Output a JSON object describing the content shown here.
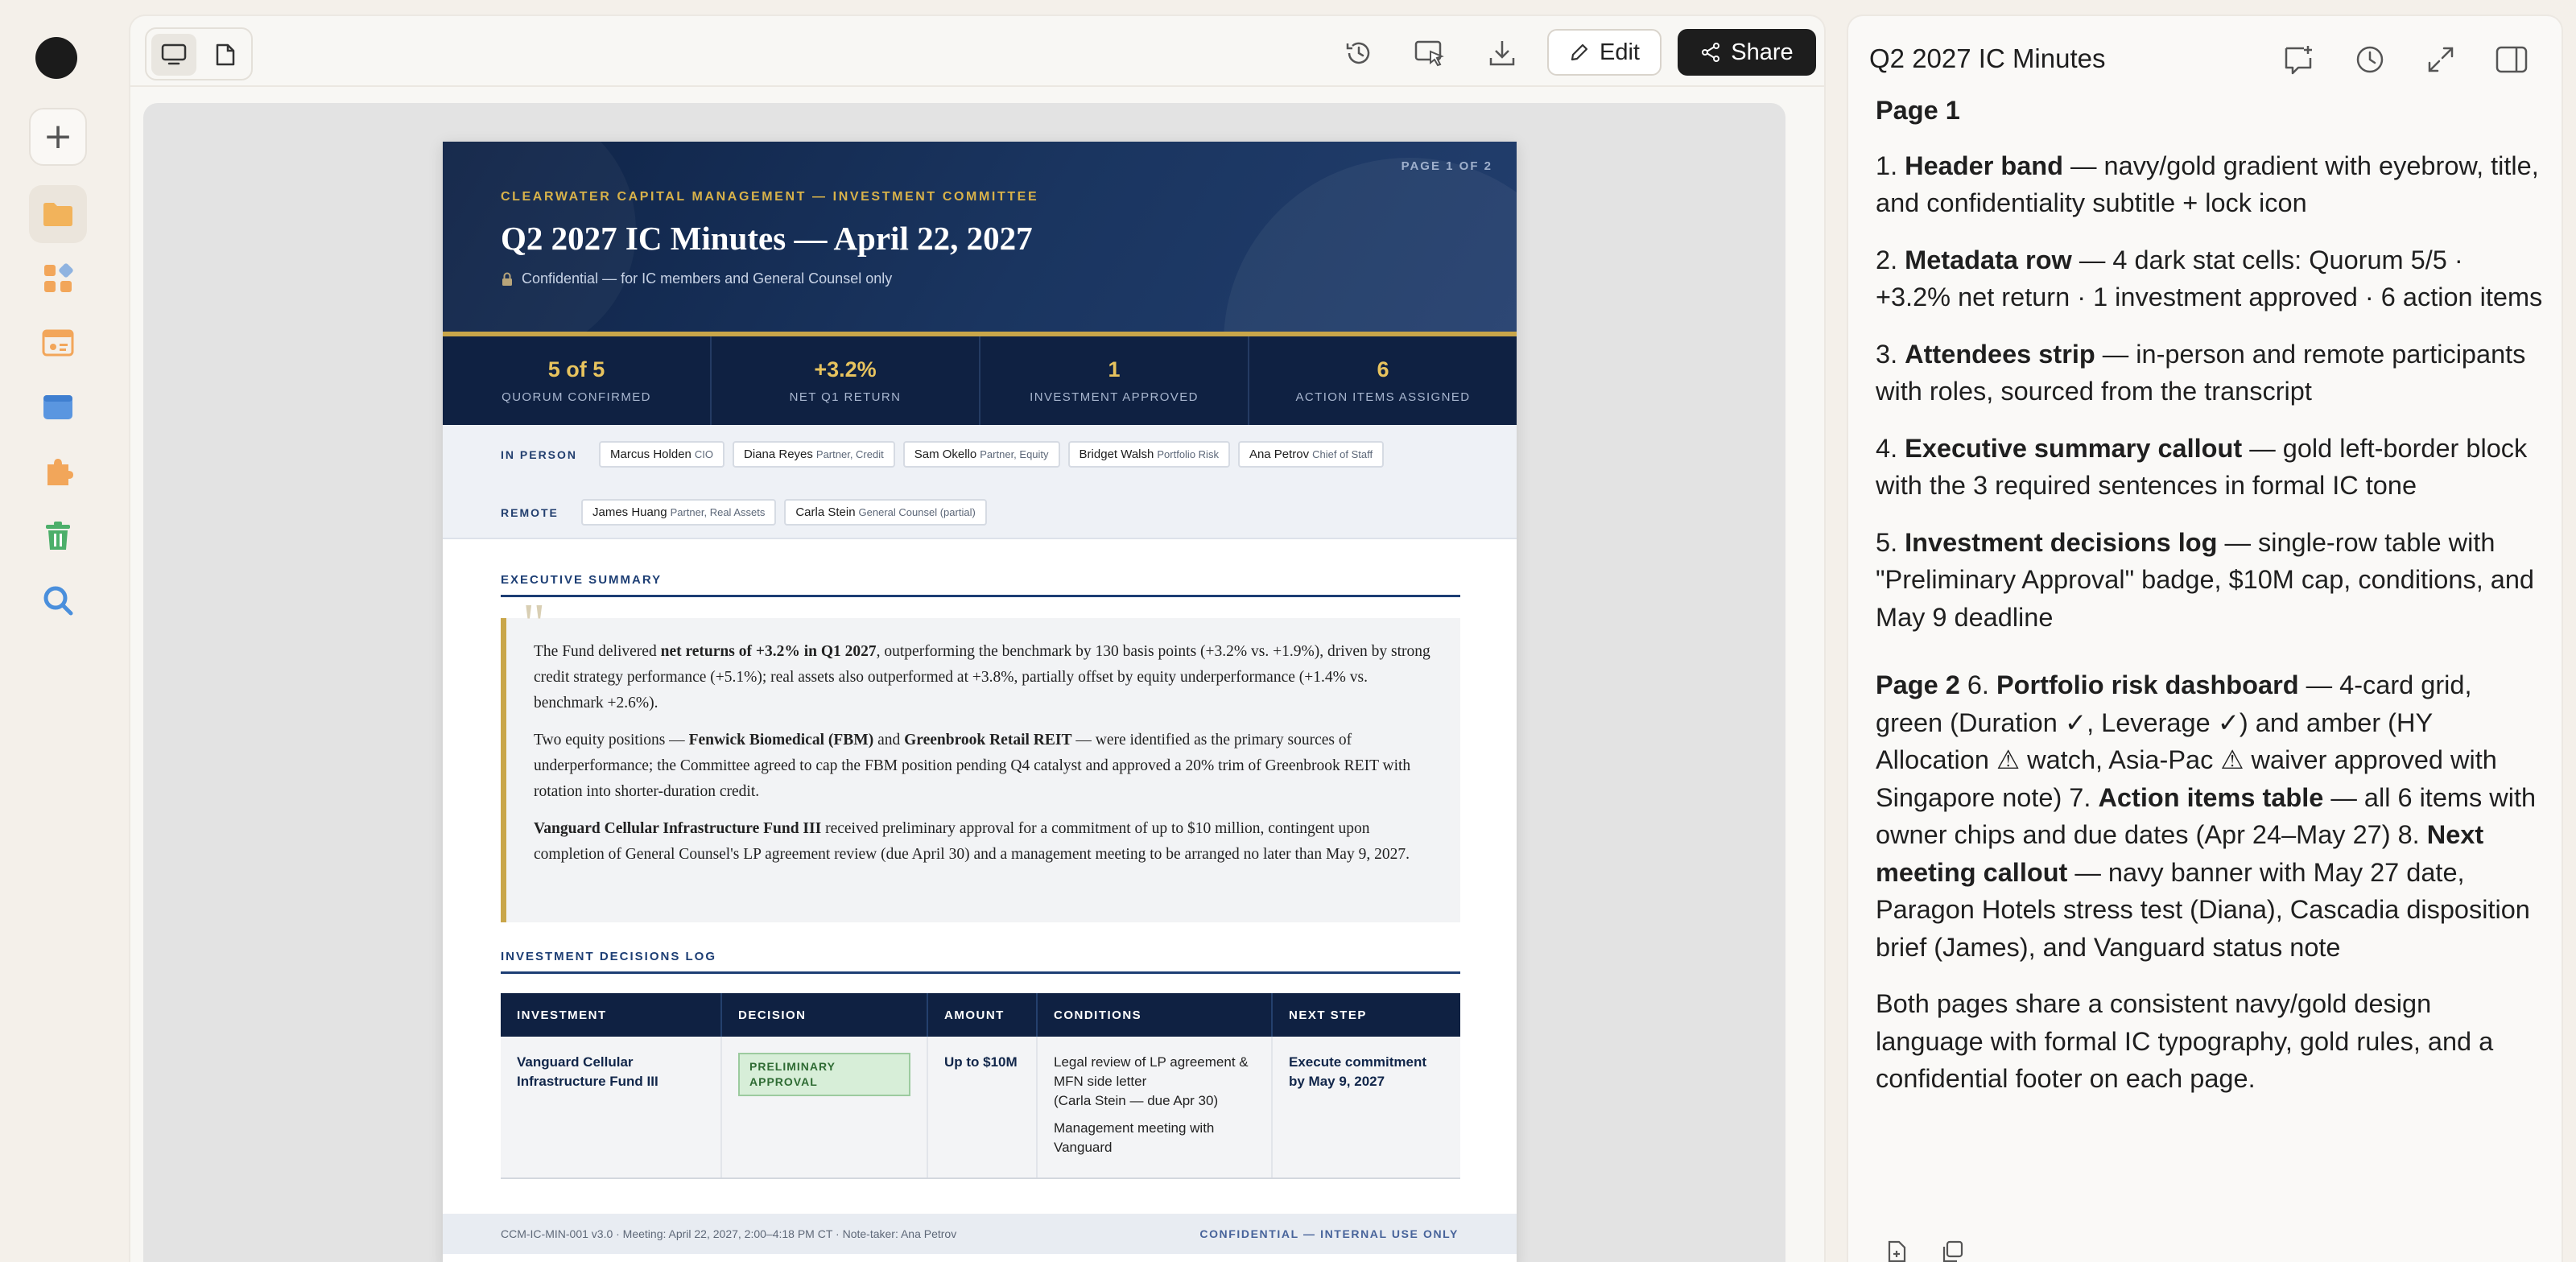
{
  "toolbar": {
    "edit_label": "Edit",
    "share_label": "Share"
  },
  "doc": {
    "page_label": "PAGE 1 OF 2",
    "eyebrow": "CLEARWATER CAPITAL MANAGEMENT — INVESTMENT COMMITTEE",
    "title": "Q2 2027 IC Minutes — April 22, 2027",
    "subtitle": "Confidential — for IC members and General Counsel only",
    "stats": [
      {
        "value": "5 of 5",
        "label": "QUORUM CONFIRMED"
      },
      {
        "value": "+3.2%",
        "label": "NET Q1 RETURN"
      },
      {
        "value": "1",
        "label": "INVESTMENT APPROVED"
      },
      {
        "value": "6",
        "label": "ACTION ITEMS ASSIGNED"
      }
    ],
    "in_person_label": "IN PERSON",
    "in_person": [
      {
        "name": "Marcus Holden",
        "role": "CIO"
      },
      {
        "name": "Diana Reyes",
        "role": "Partner, Credit"
      },
      {
        "name": "Sam Okello",
        "role": "Partner, Equity"
      },
      {
        "name": "Bridget Walsh",
        "role": "Portfolio Risk"
      },
      {
        "name": "Ana Petrov",
        "role": "Chief of Staff"
      }
    ],
    "remote_label": "REMOTE",
    "remote": [
      {
        "name": "James Huang",
        "role": "Partner, Real Assets"
      },
      {
        "name": "Carla Stein",
        "role": "General Counsel (partial)"
      }
    ],
    "exec_heading": "EXECUTIVE SUMMARY",
    "exec": {
      "p1_a": "The Fund delivered ",
      "p1_b": "net returns of +3.2% in Q1 2027",
      "p1_c": ", outperforming the benchmark by 130 basis points (+3.2% vs. +1.9%), driven by strong credit strategy performance (+5.1%); real assets also outperformed at +3.8%, partially offset by equity underperformance (+1.4% vs. benchmark +2.6%).",
      "p2_a": "Two equity positions — ",
      "p2_b": "Fenwick Biomedical (FBM)",
      "p2_c": " and ",
      "p2_d": "Greenbrook Retail REIT",
      "p2_e": " — were identified as the primary sources of underperformance; the Committee agreed to cap the FBM position pending Q4 catalyst and approved a 20% trim of Greenbrook REIT with rotation into shorter-duration credit.",
      "p3_a": "Vanguard Cellular Infrastructure Fund III",
      "p3_b": " received preliminary approval for a commitment of up to $10 million, contingent upon completion of General Counsel's LP agreement review (due April 30) and a management meeting to be arranged no later than May 9, 2027."
    },
    "log_heading": "INVESTMENT DECISIONS LOG",
    "log_headers": [
      "INVESTMENT",
      "DECISION",
      "AMOUNT",
      "CONDITIONS",
      "NEXT STEP"
    ],
    "log_row": {
      "investment": "Vanguard Cellular Infrastructure Fund III",
      "decision": "PRELIMINARY APPROVAL",
      "amount": "Up to $10M",
      "cond1": "Legal review of LP agreement & MFN side letter",
      "cond1_note": "(Carla Stein — due Apr 30)",
      "cond2": "Management meeting with Vanguard",
      "next": "Execute commitment by May 9, 2027"
    },
    "footer_left": "CCM-IC-MIN-001 v3.0  ·  Meeting: April 22, 2027, 2:00–4:18 PM CT  ·  Note-taker: Ana Petrov",
    "footer_right": "CONFIDENTIAL — INTERNAL USE ONLY"
  },
  "panel": {
    "title": "Q2 2027 IC Minutes",
    "page1": "Page 1",
    "items": [
      {
        "n": "1. ",
        "b": "Header band",
        "t": " — navy/gold gradient with eyebrow, title, and confidentiality subtitle + lock icon"
      },
      {
        "n": "2. ",
        "b": "Metadata row",
        "t": " — 4 dark stat cells: Quorum 5/5 · +3.2% net return · 1 investment approved · 6 action items"
      },
      {
        "n": "3. ",
        "b": "Attendees strip",
        "t": " — in-person and remote participants with roles, sourced from the transcript"
      },
      {
        "n": "4. ",
        "b": "Executive summary callout",
        "t": " — gold left-border block with the 3 required sentences in formal IC tone"
      },
      {
        "n": "5. ",
        "b": "Investment decisions log",
        "t": " — single-row table with \"Preliminary Approval\" badge, $10M cap, conditions, and May 9 deadline"
      }
    ],
    "page2": {
      "head": "Page 2",
      "n6": " 6. ",
      "b6": "Portfolio risk dashboard",
      "t6": " — 4-card grid, green (Duration ✓, Leverage ✓) and amber (HY Allocation ⚠ watch, Asia-Pac ⚠ waiver approved with Singapore note) 7. ",
      "b7": "Action items table",
      "t7": " — all 6 items with owner chips and due dates (Apr 24–May 27) 8. ",
      "b8": "Next meeting callout",
      "t8": " — navy banner with May 27 date, Paragon Hotels stress test (Diana), Cascadia disposition brief (James), and Vanguard status note"
    },
    "closing": "Both pages share a consistent navy/gold design language with formal IC typography, gold rules, and a confidential footer on each page."
  }
}
